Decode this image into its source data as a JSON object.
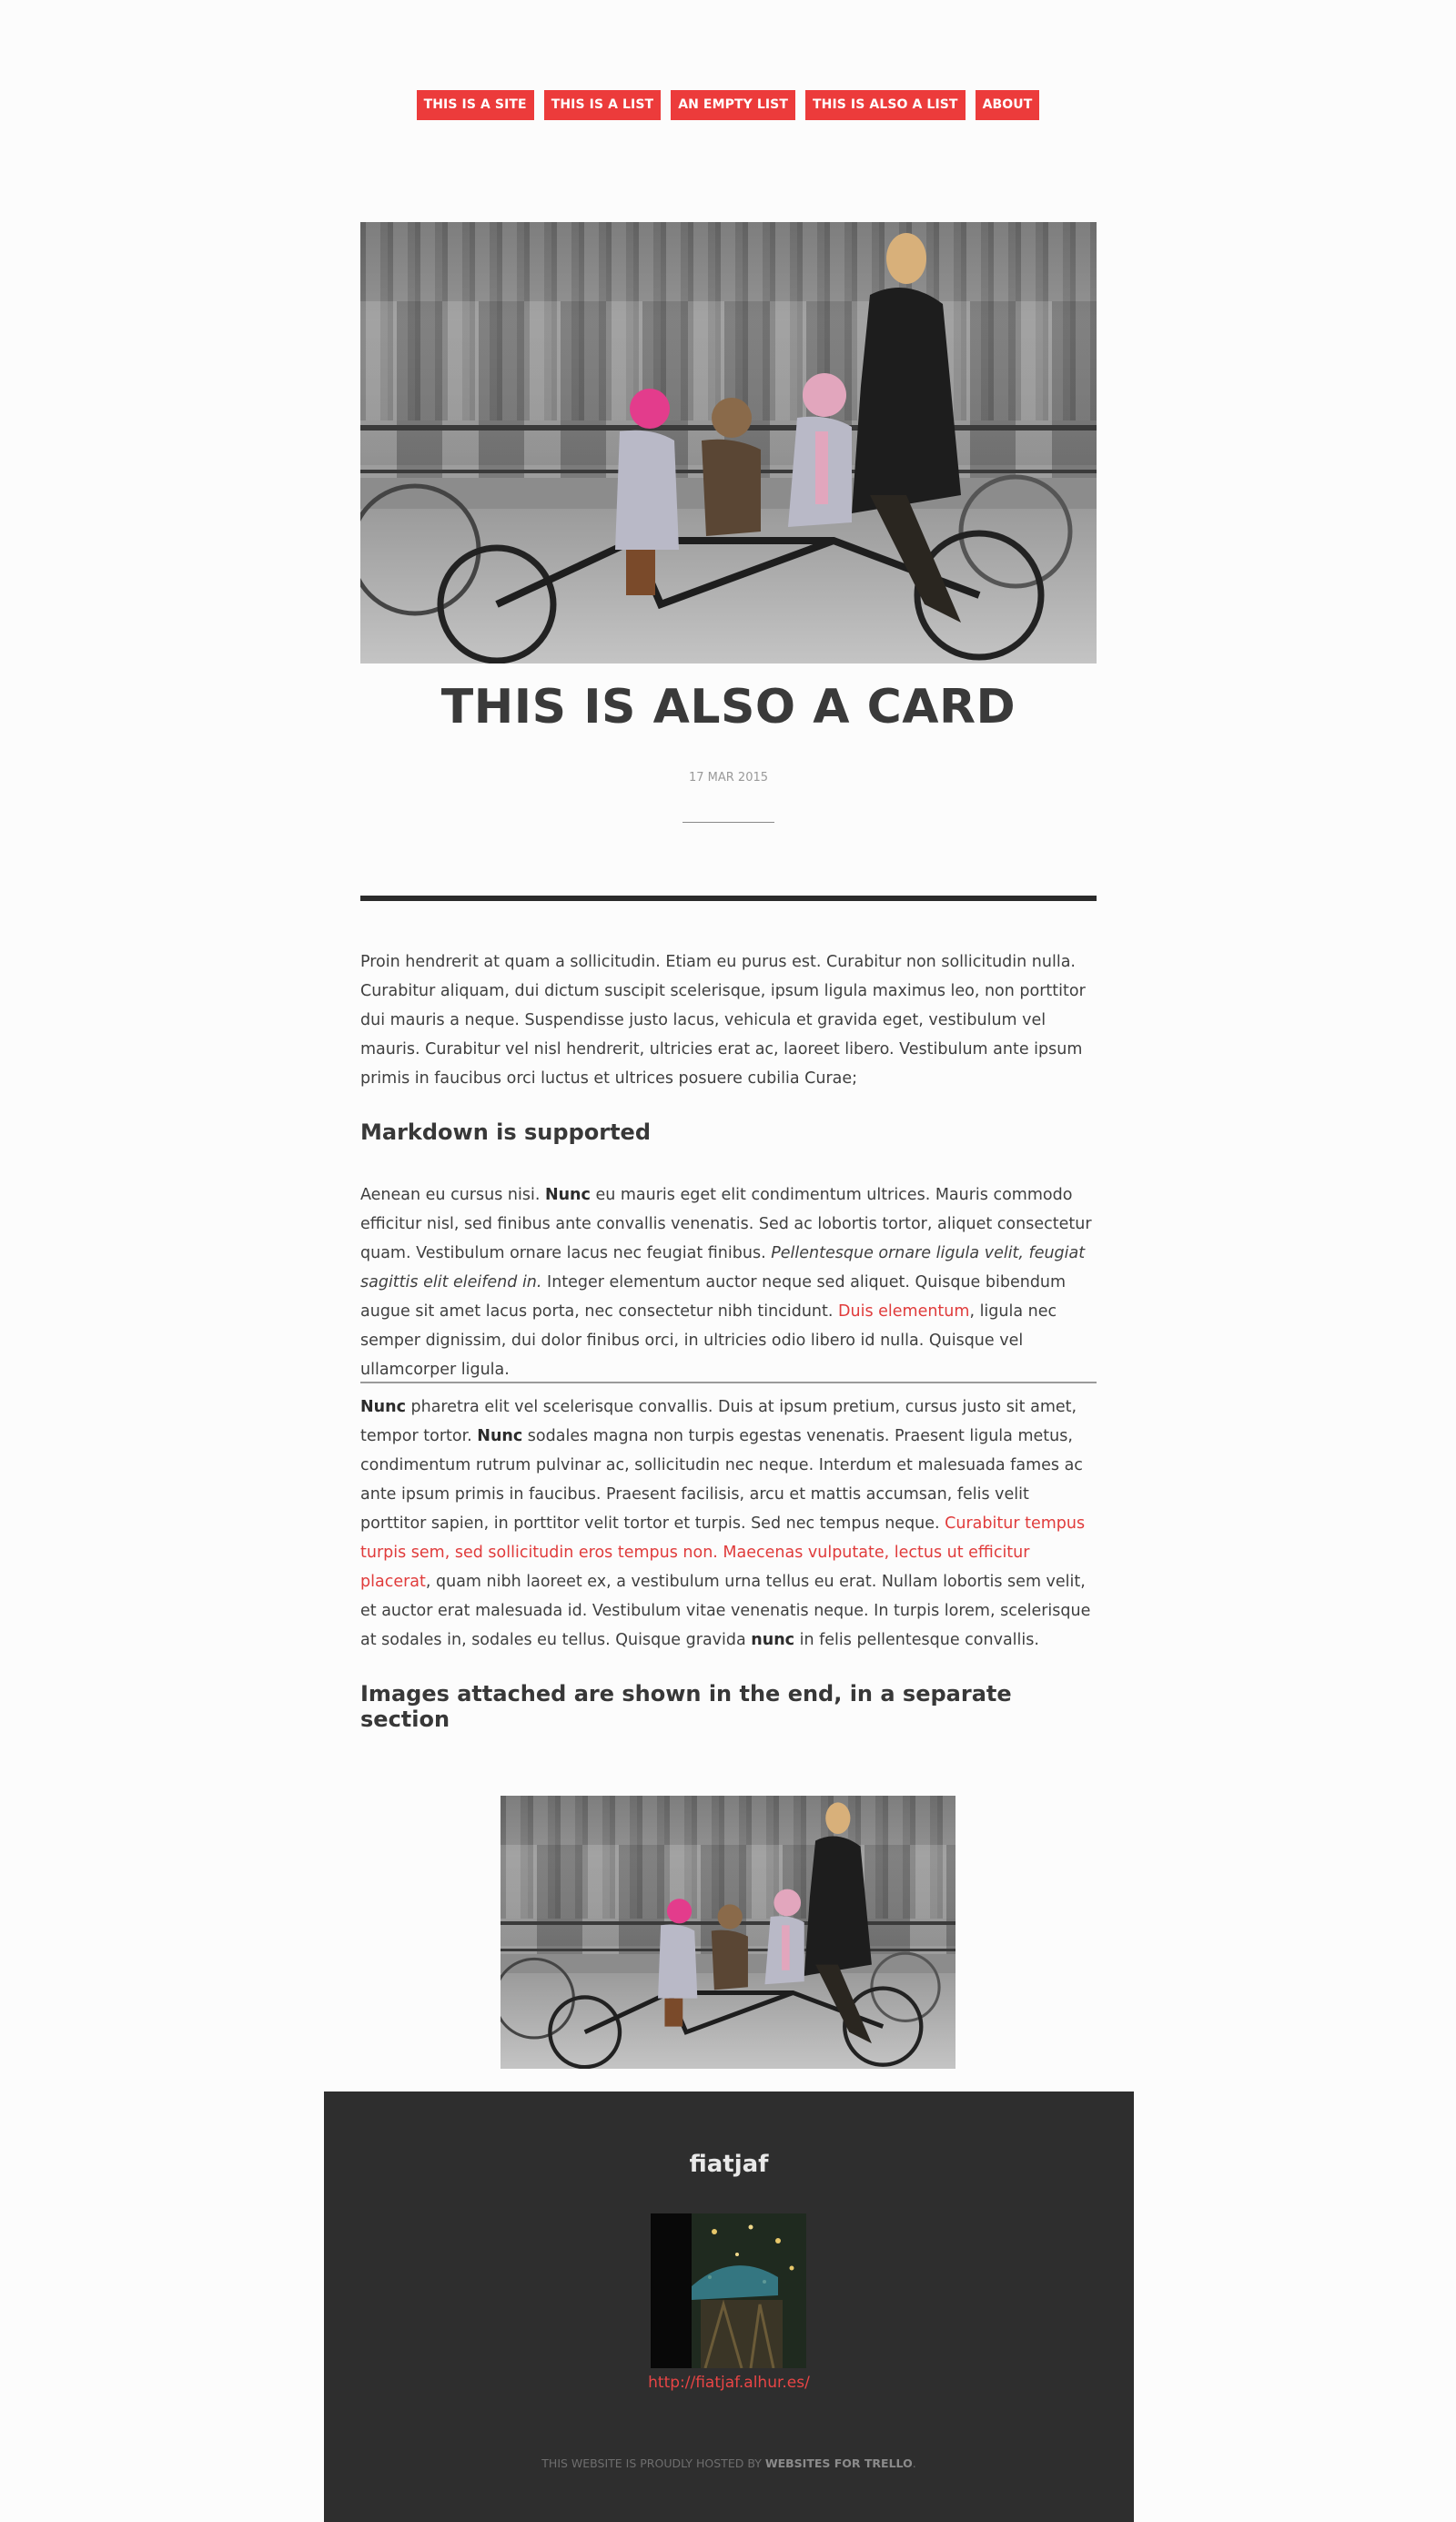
{
  "nav": {
    "items": [
      {
        "label": "THIS IS A SITE"
      },
      {
        "label": "THIS IS A LIST"
      },
      {
        "label": "AN EMPTY LIST"
      },
      {
        "label": "THIS IS ALSO A LIST"
      },
      {
        "label": "ABOUT"
      }
    ]
  },
  "colors": {
    "accent": "#ec3b3b",
    "text": "#3d3d3d",
    "footer_bg": "#2e2e2e",
    "page_bg": "#fcfcfc"
  },
  "card": {
    "title": "THIS IS ALSO A CARD",
    "date": "17 MAR 2015",
    "hero_image_icon": "family-tandem-bicycle-photo"
  },
  "content": {
    "p1": "Proin hendrerit at quam a sollicitudin. Etiam eu purus est. Curabitur non sollicitudin nulla. Curabitur aliquam, dui dictum suscipit scelerisque, ipsum ligula maximus leo, non porttitor dui mauris a neque. Suspendisse justo lacus, vehicula et gravida eget, vestibulum vel mauris. Curabitur vel nisl hendrerit, ultricies erat ac, laoreet libero. Vestibulum ante ipsum primis in faucibus orci luctus et ultrices posuere cubilia Curae;",
    "heading_markdown": "Markdown is supported",
    "p2": {
      "a": "Aenean eu cursus nisi. ",
      "bold1": "Nunc",
      "b": " eu mauris eget elit condimentum ultrices. Mauris commodo efficitur nisl, sed finibus ante convallis venenatis. Sed ac lobortis tortor, aliquet consectetur quam. Vestibulum ornare lacus nec feugiat finibus. ",
      "italic": "Pellentesque ornare ligula velit, feugiat sagittis elit eleifend in.",
      "c": " Integer elementum auctor neque sed aliquet. Quisque bibendum augue sit amet lacus porta, nec consectetur nibh tincidunt. ",
      "link": "Duis elementum",
      "d": ", ligula nec semper dignissim, dui dolor finibus orci, in ultricies odio libero id nulla. Quisque vel ullamcorper ligula."
    },
    "p3": {
      "bold1": "Nunc",
      "a": " pharetra elit vel scelerisque convallis. Duis at ipsum pretium, cursus justo sit amet, tempor tortor. ",
      "bold2": "Nunc",
      "b": " sodales magna non turpis egestas venenatis. Praesent ligula metus, condimentum rutrum pulvinar ac, sollicitudin nec neque. Interdum et malesuada fames ac ante ipsum primis in faucibus. Praesent facilisis, arcu et mattis accumsan, felis velit porttitor sapien, in porttitor velit tortor et turpis. Sed nec tempus neque. ",
      "link": "Curabitur tempus turpis sem, sed sollicitudin eros tempus non. Maecenas vulputate, lectus ut efficitur placerat",
      "c": ", quam nibh laoreet ex, a vestibulum urna tellus eu erat. Nullam lobortis sem velit, et auctor erat malesuada id. Vestibulum vitae venenatis neque. In turpis lorem, scelerisque at sodales in, sodales eu tellus. Quisque gravida ",
      "bold3": "nunc",
      "d": " in felis pellentesque convallis."
    },
    "heading_images": "Images attached are shown in the end, in a separate section"
  },
  "footer": {
    "name": "fiatjaf",
    "avatar_icon": "avatar-photo",
    "link": "http://fiatjaf.alhur.es/",
    "credit_prefix": "THIS WEBSITE IS PROUDLY HOSTED BY ",
    "credit_brand": "WEBSITES FOR TRELLO",
    "credit_suffix": "."
  }
}
